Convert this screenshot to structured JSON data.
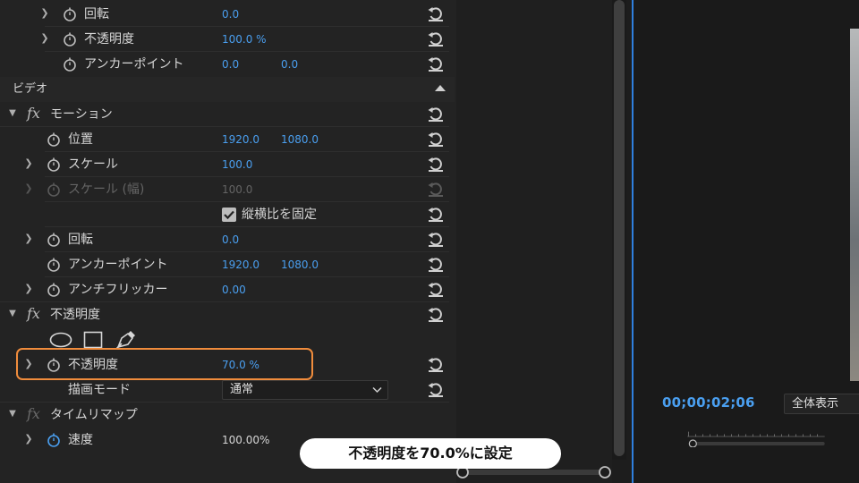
{
  "colors": {
    "accent_blue": "#4a9ff0",
    "highlight_orange": "#f08c3c",
    "panel_bg": "#232323"
  },
  "effects": {
    "top_rows": [
      {
        "label": "回転",
        "v1": "0.0",
        "v2": ""
      },
      {
        "label": "不透明度",
        "v1": "100.0 %",
        "v2": ""
      },
      {
        "label": "アンカーポイント",
        "v1": "0.0",
        "v2": "0.0"
      }
    ],
    "section_video": "ビデオ",
    "motion": {
      "title": "モーション",
      "position": {
        "label": "位置",
        "v1": "1920.0",
        "v2": "1080.0"
      },
      "scale": {
        "label": "スケール",
        "v1": "100.0"
      },
      "scale_width": {
        "label": "スケール (幅)",
        "v1": "100.0"
      },
      "uniform_scale": "縦横比を固定",
      "rotation": {
        "label": "回転",
        "v1": "0.0"
      },
      "anchor": {
        "label": "アンカーポイント",
        "v1": "1920.0",
        "v2": "1080.0"
      },
      "flicker": {
        "label": "アンチフリッカー",
        "v1": "0.00"
      }
    },
    "opacity": {
      "title": "不透明度",
      "mask_tools": [
        "ellipse-mask-icon",
        "rectangle-mask-icon",
        "pen-mask-icon"
      ],
      "opacity": {
        "label": "不透明度",
        "v1": "70.0 %"
      },
      "blend_mode": {
        "label": "描画モード",
        "value": "通常"
      }
    },
    "time_remap": {
      "title": "タイムリマップ",
      "speed": {
        "label": "速度",
        "v1": "100.00%"
      }
    }
  },
  "monitor": {
    "timecode": "00;00;02;06",
    "zoom": "全体表示"
  },
  "caption": "不透明度を70.0%に設定"
}
